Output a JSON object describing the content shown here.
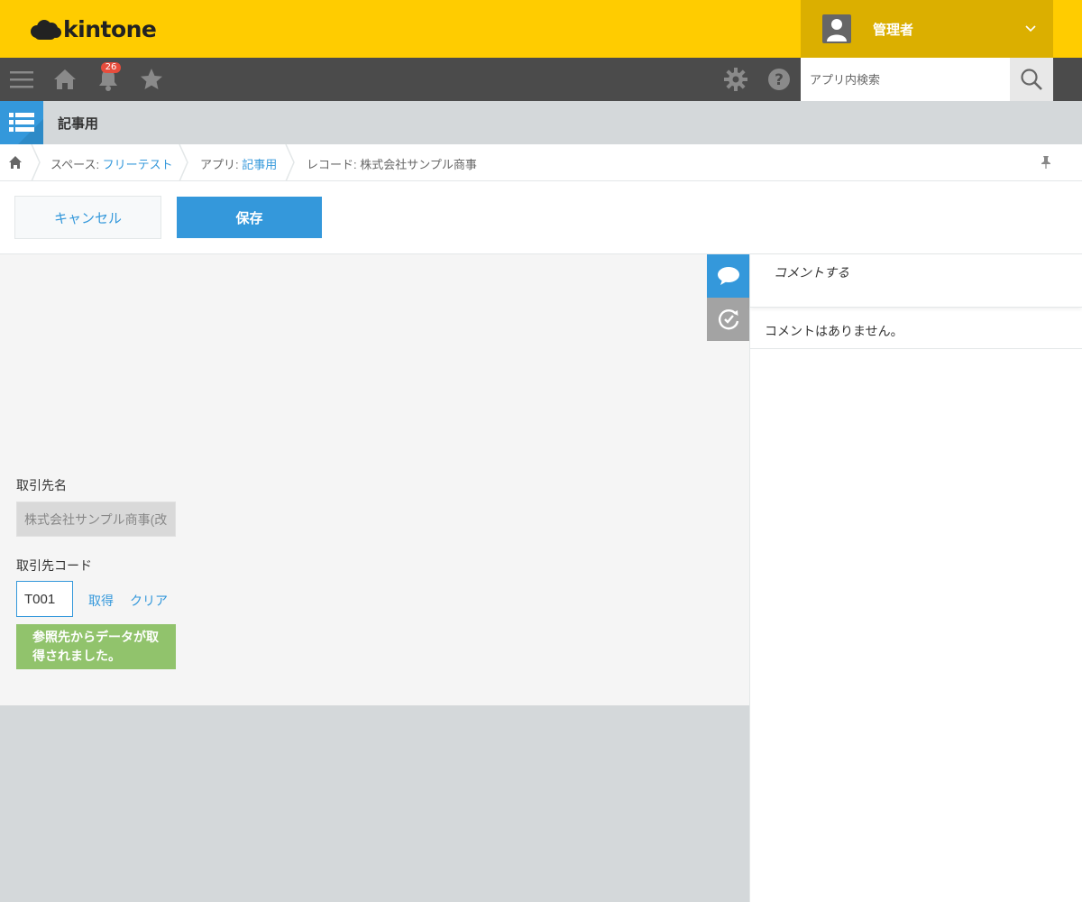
{
  "header": {
    "logo_text": "kintone",
    "user_name": "管理者",
    "notification_count": "26"
  },
  "navbar": {
    "search_placeholder": "アプリ内検索"
  },
  "app": {
    "name": "記事用"
  },
  "breadcrumb": {
    "space_prefix": "スペース: ",
    "space_name": "フリーテスト",
    "app_prefix": "アプリ: ",
    "app_name": "記事用",
    "record_label": "レコード: 株式会社サンプル商事"
  },
  "toolbar": {
    "cancel_label": "キャンセル",
    "save_label": "保存"
  },
  "form": {
    "client_name_label": "取引先名",
    "client_name_value": "株式会社サンプル商事(改",
    "client_code_label": "取引先コード",
    "client_code_value": "T001",
    "fetch_label": "取得",
    "clear_label": "クリア",
    "notice_text": "参照先からデータが取得されました。"
  },
  "comments": {
    "input_placeholder": "コメントする",
    "empty_text": "コメントはありません。"
  },
  "colors": {
    "header_yellow": "#ffcc00",
    "user_box": "#dbaf00",
    "nav_dark": "#4b4b4b",
    "accent_blue": "#3498db",
    "success_green": "#91c36c"
  }
}
